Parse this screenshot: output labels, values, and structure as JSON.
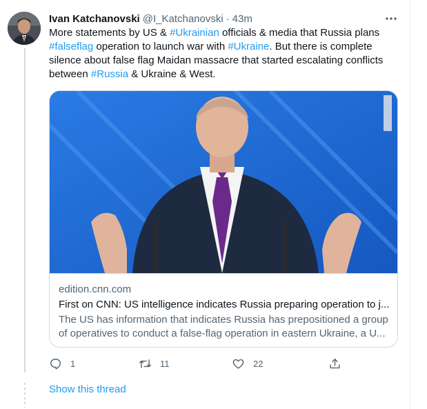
{
  "tweet": {
    "author_name": "Ivan Katchanovski",
    "handle": "@I_Katchanovski",
    "separator": "·",
    "time": "43m",
    "text_parts": [
      {
        "t": "More statements by US & ",
        "tag": false
      },
      {
        "t": "#Ukrainian",
        "tag": true
      },
      {
        "t": " officials & media that Russia plans ",
        "tag": false
      },
      {
        "t": "#falseflag",
        "tag": true
      },
      {
        "t": " operation to launch war with ",
        "tag": false
      },
      {
        "t": "#Ukraine",
        "tag": true
      },
      {
        "t": ". But there is complete silence about false flag Maidan massacre that started escalating conflicts between ",
        "tag": false
      },
      {
        "t": "#Russia",
        "tag": true
      },
      {
        "t": " & Ukraine & West.",
        "tag": false
      }
    ]
  },
  "card": {
    "domain": "edition.cnn.com",
    "title": "First on CNN: US intelligence indicates Russia preparing operation to j...",
    "description": "The US has information that indicates Russia has prepositioned a group of operatives to conduct a false-flag operation in eastern Ukraine, a U..."
  },
  "actions": {
    "replies": "1",
    "retweets": "11",
    "likes": "22"
  },
  "show_thread": "Show this thread",
  "colors": {
    "accent": "#1d9bf0",
    "secondary_text": "#536471",
    "border": "#cfd9de"
  }
}
